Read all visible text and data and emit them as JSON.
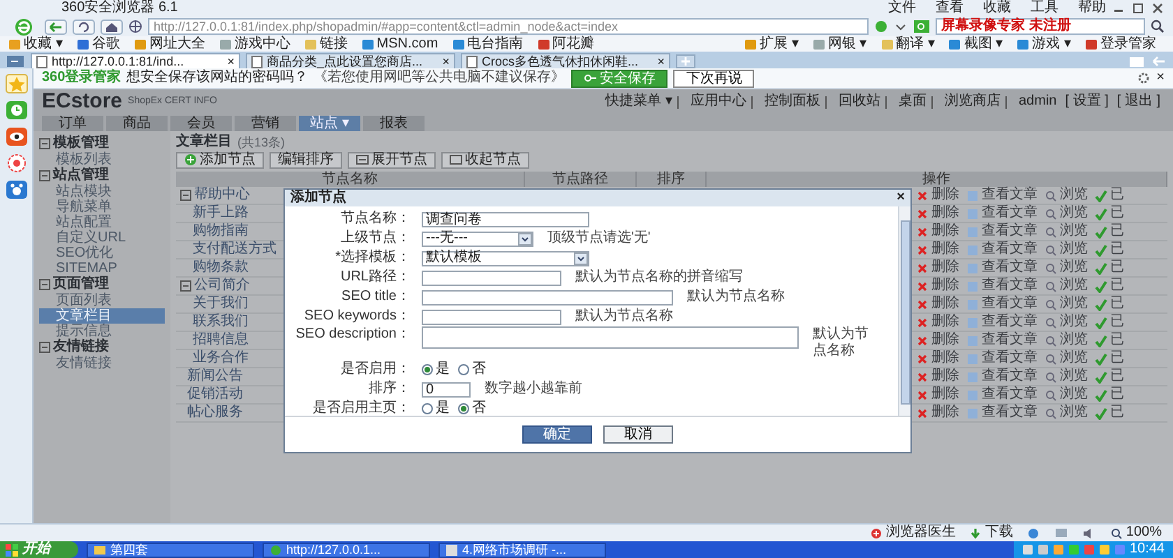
{
  "browser": {
    "title": "360安全浏览器 6.1",
    "menu": [
      "文件",
      "查看",
      "收藏",
      "工具",
      "帮助"
    ],
    "url": "http://127.0.0.1:81/index.php/shopadmin/#app=content&ctl=admin_node&act=index",
    "search_text": "屏幕录像专家 未注册",
    "bookmarks": [
      {
        "label": "收藏",
        "caret": "▾"
      },
      {
        "label": "谷歌"
      },
      {
        "label": "网址大全"
      },
      {
        "label": "游戏中心"
      },
      {
        "label": "链接"
      },
      {
        "label": "MSN.com"
      },
      {
        "label": "电台指南"
      },
      {
        "label": "阿花瓣"
      }
    ],
    "tools": [
      {
        "label": "扩展",
        "caret": "▾"
      },
      {
        "label": "网银",
        "caret": "▾"
      },
      {
        "label": "翻译",
        "caret": "▾"
      },
      {
        "label": "截图",
        "caret": "▾"
      },
      {
        "label": "游戏",
        "caret": "▾"
      },
      {
        "label": "登录管家"
      }
    ],
    "tabs": [
      {
        "label": "http://127.0.0.1:81/ind...",
        "close": "×",
        "selected": true
      },
      {
        "label": "商品分类_点此设置您商店...",
        "close": "×",
        "selected": false
      },
      {
        "label": "Crocs多色透气休扣休闲鞋...",
        "close": "×",
        "selected": false
      }
    ]
  },
  "password_bar": {
    "brand": "360登录管家",
    "question": "想安全保存该网站的密码吗？",
    "hint": "《若您使用网吧等公共电脑不建议保存》",
    "save": "安全保存",
    "later": "下次再说",
    "close": "×"
  },
  "admin": {
    "logo": "ECstore",
    "cert": "ShopEx CERT INFO",
    "links": [
      {
        "label": "快捷菜单",
        "caret": "▾"
      },
      {
        "label": "应用中心"
      },
      {
        "label": "控制面板"
      },
      {
        "label": "回收站"
      },
      {
        "label": "桌面"
      },
      {
        "label": "浏览商店"
      }
    ],
    "user": "admin",
    "user_links": [
      "[ 设置 ]",
      "[ 退出 ]"
    ],
    "nav": [
      {
        "label": "订单",
        "selected": false
      },
      {
        "label": "商品",
        "selected": false
      },
      {
        "label": "会员",
        "selected": false
      },
      {
        "label": "营销",
        "selected": false
      },
      {
        "label": "站点",
        "caret": "▾",
        "selected": true
      },
      {
        "label": "报表",
        "selected": false
      }
    ]
  },
  "sidebar": [
    {
      "title": "模板管理",
      "items": [
        {
          "label": "模板列表",
          "selected": false
        }
      ]
    },
    {
      "title": "站点管理",
      "items": [
        {
          "label": "站点模块",
          "selected": false
        },
        {
          "label": "导航菜单",
          "selected": false
        },
        {
          "label": "站点配置",
          "selected": false
        },
        {
          "label": "自定义URL",
          "selected": false
        },
        {
          "label": "SEO优化",
          "selected": false
        },
        {
          "label": "SITEMAP",
          "selected": false
        }
      ]
    },
    {
      "title": "页面管理",
      "items": [
        {
          "label": "页面列表",
          "selected": false
        },
        {
          "label": "文章栏目",
          "selected": true
        },
        {
          "label": "提示信息",
          "selected": false
        }
      ]
    },
    {
      "title": "友情链接",
      "items": [
        {
          "label": "友情链接",
          "selected": false
        }
      ]
    }
  ],
  "content": {
    "title": "文章栏目",
    "count": "(共13条)",
    "toolbar": [
      {
        "label": "添加节点",
        "kind": "add"
      },
      {
        "label": "编辑排序",
        "kind": "plain"
      },
      {
        "label": "展开节点",
        "kind": "expand"
      },
      {
        "label": "收起节点",
        "kind": "collapse"
      }
    ],
    "columns": [
      "节点名称",
      "节点路径",
      "排序",
      "操作"
    ],
    "rows": [
      {
        "name": "帮助中心",
        "actions": [
          "删除",
          "查看文章",
          "浏览",
          "已"
        ],
        "children": [
          {
            "name": "新手上路",
            "actions": [
              "删除",
              "查看文章",
              "浏览",
              "已"
            ]
          },
          {
            "name": "购物指南",
            "actions": [
              "删除",
              "查看文章",
              "浏览",
              "已"
            ]
          },
          {
            "name": "支付配送方式",
            "actions": [
              "删除",
              "查看文章",
              "浏览",
              "已"
            ]
          },
          {
            "name": "购物条款",
            "actions": [
              "删除",
              "查看文章",
              "浏览",
              "已"
            ]
          }
        ]
      },
      {
        "name": "公司简介",
        "actions": [
          "删除",
          "查看文章",
          "浏览",
          "已"
        ],
        "children": [
          {
            "name": "关于我们",
            "actions": [
              "删除",
              "查看文章",
              "浏览",
              "已"
            ]
          },
          {
            "name": "联系我们",
            "actions": [
              "删除",
              "查看文章",
              "浏览",
              "已"
            ]
          },
          {
            "name": "招聘信息",
            "actions": [
              "删除",
              "查看文章",
              "浏览",
              "已"
            ]
          },
          {
            "name": "业务合作",
            "actions": [
              "删除",
              "查看文章",
              "浏览",
              "已"
            ]
          }
        ]
      },
      {
        "name": "新闻公告",
        "actions": [
          "删除",
          "查看文章",
          "浏览",
          "已"
        ]
      },
      {
        "name": "促销活动",
        "actions": [
          "删除",
          "查看文章",
          "浏览",
          "已"
        ]
      },
      {
        "name": "帖心服务",
        "actions": [
          "删除",
          "查看文章",
          "浏览",
          "已"
        ]
      }
    ]
  },
  "dialog": {
    "title": "添加节点",
    "close": "×",
    "fields": [
      {
        "kind": "text",
        "label": "节点名称：",
        "value": "调查问卷"
      },
      {
        "kind": "select",
        "label": "上级节点：",
        "value": "---无---",
        "hint": "顶级节点请选'无'"
      },
      {
        "kind": "select",
        "label": "*选择模板：",
        "value": "默认模板"
      },
      {
        "kind": "text",
        "label": "URL路径：",
        "hint": "默认为节点名称的拼音缩写"
      },
      {
        "kind": "text",
        "label": "SEO title：",
        "hint": "默认为节点名称"
      },
      {
        "kind": "text",
        "label": "SEO keywords：",
        "hint": "默认为节点名称"
      },
      {
        "kind": "textarea",
        "label": "SEO description：",
        "hint": "默认为节点名称"
      },
      {
        "kind": "radio",
        "label": "是否启用：",
        "options": [
          {
            "label": "是",
            "selected": true
          },
          {
            "label": "否",
            "selected": false
          }
        ]
      },
      {
        "kind": "text",
        "label": "排序：",
        "value": "0",
        "hint": "数字越小越靠前"
      },
      {
        "kind": "radio",
        "label": "是否启用主页：",
        "options": [
          {
            "label": "是",
            "selected": false
          },
          {
            "label": "否",
            "selected": true
          }
        ]
      }
    ],
    "buttons": [
      {
        "label": "确定",
        "kind": "primary"
      },
      {
        "label": "取消",
        "kind": "secondary"
      }
    ]
  },
  "status_bar": {
    "items": [
      "浏览器医生",
      "下载"
    ],
    "zoom": "100%"
  },
  "taskbar": {
    "start": "开始",
    "tasks": [
      "第四套",
      "http://127.0.0.1...",
      "4.网络市场调研 -..."
    ],
    "clock": "10:44"
  }
}
